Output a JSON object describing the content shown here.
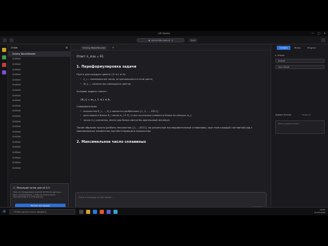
{
  "window": {
    "title": "LM Studio",
    "minimize": "—",
    "maximize": "□",
    "close": "✕"
  },
  "topbar": {
    "model": "llama3-8b-instruct",
    "eject": "Eject"
  },
  "chats": {
    "header": "Chats",
    "items": [
      "Solving WazarWooden",
      "Untitled",
      "Untitled",
      "Untitled",
      "Untitled",
      "Untitled",
      "Untitled",
      "Untitled",
      "Untitled",
      "Untitled",
      "Untitled",
      "Untitled",
      "Untitled",
      "Untitled",
      "Untitled",
      "Untitled",
      "Untitled",
      "Untitled",
      "Untitled",
      "Untitled",
      "Untitled",
      "Untitled",
      "Untitled"
    ]
  },
  "update": {
    "title": "Миграция чатов для v0.3.0",
    "body": "Чаты из предыдущих версий LM Studio должны быть мигрированы, чтобы их можно было просматривать в этой версии.",
    "button": "Начать миграцию"
  },
  "main": {
    "tab": "Solving WazarWooden",
    "formula_head": "Ответ: k_max = 91.",
    "section1": "1. Переформулировка задачи",
    "p1": "Пусть для каждого цвета i (1 ≤ i ≤ 5):",
    "b1": "n_i — минимальное число, встречающееся в этом цвете;",
    "b2": "|R_i| — количество имеющихся цветов.",
    "p2": "Условие задачи гласит:",
    "formula": "|R_i| = m_i,        1 ≤ i ≤ k.",
    "p3": "Следовательно:",
    "b3": "множества R_1, …, R_k являются разбиением {1, 2, …, 4321};",
    "b4": "дескладного блока R_i число m_i ∈ R_i и все остальные элементы блока не меньше m_i;",
    "b5": "числа m_i различны, иначе два блока имели бы одинаковый минимум.",
    "p4": "Таким образом нужно разбить множество {1,…,4321} на различные последовательные сплавливы, при этом каждый составной ряд с минимальным элементом соответствующего множества.",
    "section2": "2. Максимальное число сплавиных",
    "placeholder": "Send a message to the model...",
    "chip1": "Reasoning Effort",
    "chip2": "Append",
    "send_key": "Ctrl + Enter",
    "send": "Send"
  },
  "right": {
    "tabs": [
      "Context",
      "Model",
      "Program"
    ],
    "preset_label": "Preset",
    "preset_value": "Default",
    "preset_button": "Save Preset",
    "sys_label": "System Prompt",
    "sys_placeholder": "Enter a system prompt...",
    "token_count": "Tokens 0"
  },
  "taskbar": {
    "search": "Чтобы начать поиск, введите",
    "time": "10:25",
    "date": "27.03.2025"
  }
}
